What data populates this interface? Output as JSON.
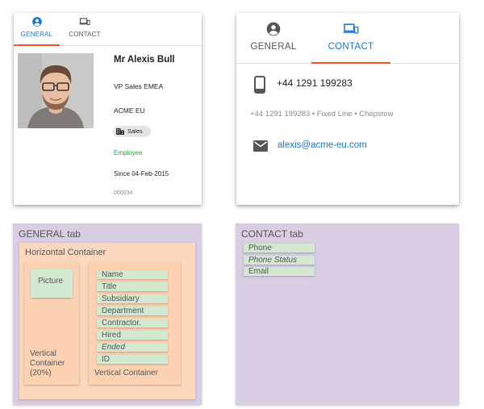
{
  "card_general": {
    "tabs": [
      {
        "label": "GENERAL",
        "icon": "account-circle-icon",
        "active": true
      },
      {
        "label": "CONTACT",
        "icon": "devices-icon",
        "active": false
      }
    ],
    "name": "Mr Alexis Bull",
    "title": "VP Sales EMEA",
    "subsidiary": "ACME EU",
    "department": "Sales",
    "contract": "Employee",
    "hired": "Since 04-Feb-2015",
    "id": "000034"
  },
  "card_contact": {
    "tabs": [
      {
        "label": "GENERAL",
        "icon": "account-circle-icon",
        "active": false
      },
      {
        "label": "CONTACT",
        "icon": "devices-icon",
        "active": true
      }
    ],
    "phone": "+44 1291 199283",
    "phone_status": "+44 1291 199283 • Fixed Line • Chepstow",
    "email": "alexis@acme-eu.com"
  },
  "diagram": {
    "general": {
      "title": "GENERAL tab",
      "horizontal_container": "Horizontal Container",
      "left_container_label": "Vertical Container (20%)",
      "picture": "Picture",
      "right_container_label": "Vertical Container",
      "fields": [
        {
          "label": "Name",
          "italic": false
        },
        {
          "label": "Title",
          "italic": false
        },
        {
          "label": "Subsidiary",
          "italic": false
        },
        {
          "label": "Department",
          "italic": false
        },
        {
          "label": "Contractor.",
          "italic": false
        },
        {
          "label": "Hired",
          "italic": false
        },
        {
          "label": "Ended",
          "italic": true
        },
        {
          "label": "ID",
          "italic": false
        }
      ]
    },
    "contact": {
      "title": "CONTACT tab",
      "fields": [
        {
          "label": "Phone",
          "italic": false
        },
        {
          "label": "Phone Status",
          "italic": true
        },
        {
          "label": "Email",
          "italic": false
        }
      ]
    }
  },
  "colors": {
    "accent_blue": "#1976d2",
    "tab_underline": "#f4511e",
    "employee_green": "#2e9e3e",
    "lavender": "#d9cde4",
    "peach": "#fbd8bd",
    "field_green": "#d2e8d1"
  }
}
